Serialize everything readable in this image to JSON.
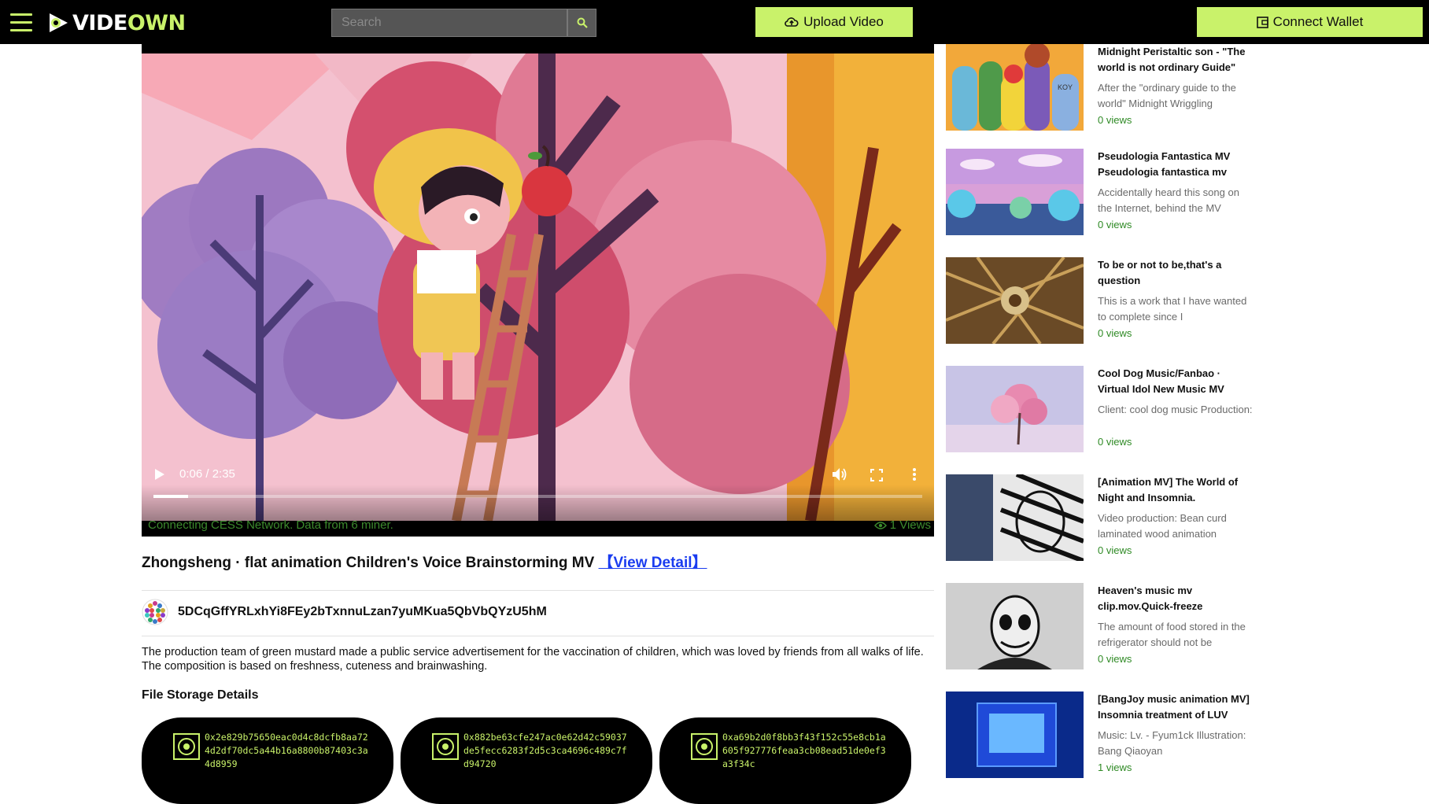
{
  "header": {
    "logo_prefix": "VIDE",
    "logo_accent": "OWN",
    "search_placeholder": "Search",
    "upload_label": "Upload Video",
    "wallet_label": "Connect Wallet",
    "accent_color": "#c9f26a"
  },
  "player": {
    "current_time": "0:06",
    "duration": "2:35",
    "time_display": "0:06 / 2:35",
    "progress_fraction": 0.045,
    "network_status": "Connecting CESS Network. Data from 6 miner.",
    "views": "1 Views"
  },
  "video": {
    "title": "Zhongsheng · flat animation Children's Voice Brainstorming MV ",
    "view_detail_label": "【View Detail】",
    "owner_address": "5DCqGffYRLxhYi8FEy2bTxnnuLzan7yuMKua5QbVbQYzU5hM",
    "description": "The production team of green mustard made a public service advertisement for the vaccination of children, which was loved by friends from all walks of life. The composition is based on freshness, cuteness and brainwashing."
  },
  "storage": {
    "heading": "File Storage Details",
    "hashes": [
      "0x2e829b75650eac0d4c8dcfb8aa724d2df70dc5a44b16a8800b87403c3a4d8959",
      "0x882be63cfe247ac0e62d42c59037de5fecc6283f2d5c3ca4696c489c7fd94720",
      "0xa69b2d0f8bb3f43f152c55e8cb1a605f927776feaa3cb08ead51de0ef3a3f34c"
    ]
  },
  "sidebar": {
    "items": [
      {
        "title": "Midnight Peristaltic son - \"The world is not ordinary Guide\"",
        "desc": "After the \"ordinary guide to the world\" Midnight Wriggling",
        "views": "0 views"
      },
      {
        "title": "Pseudologia Fantastica MV Pseudologia fantastica mv",
        "desc": "Accidentally heard this song on the Internet, behind the MV",
        "views": "0 views"
      },
      {
        "title": "To be or not to be,that's a question",
        "desc": "This is a work that I have wanted to complete since I",
        "views": "0 views"
      },
      {
        "title": "Cool Dog Music/Fanbao · Virtual Idol New Music MV",
        "desc": "Client: cool dog music Production:",
        "views": "0 views"
      },
      {
        "title": "[Animation MV] The World of Night and Insomnia.",
        "desc": "Video production: Bean curd laminated wood animation",
        "views": "0 views"
      },
      {
        "title": "Heaven's music mv clip.mov.Quick-freeze",
        "desc": "The amount of food stored in the refrigerator should not be",
        "views": "0 views"
      },
      {
        "title": "[BangJoy music animation MV] Insomnia treatment of LUV",
        "desc": "Music: Lv. - Fyum1ck Illustration: Bang Qiaoyan",
        "views": "1 views"
      }
    ],
    "thumb_labels": [
      "KOY"
    ]
  }
}
